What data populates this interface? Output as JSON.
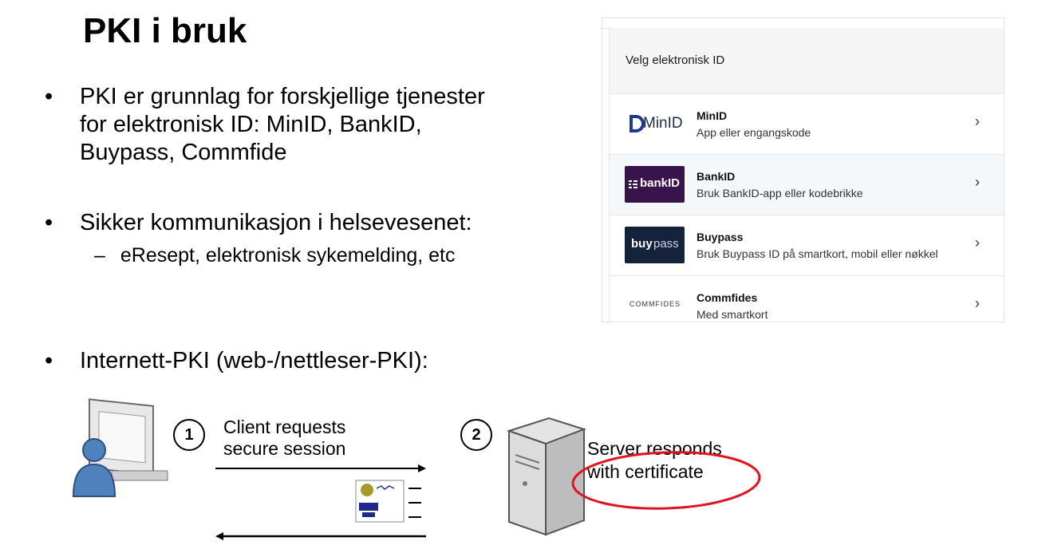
{
  "title": "PKI i bruk",
  "bullets": [
    {
      "lines": [
        "PKI er grunnlag for forskjellige tjenester",
        "for elektronisk ID: MinID, BankID,",
        "Buypass, Commfide"
      ]
    },
    {
      "lines": [
        "Sikker kommunikasjon i helsevesenet:"
      ]
    },
    {
      "lines": [
        "Internett-PKI (web-/nettleser-PKI):"
      ]
    }
  ],
  "bullet_symbol": "•",
  "sub_bullet": {
    "dash": "–",
    "text": "eResept, elektronisk sykemelding, etc"
  },
  "eid_panel": {
    "header": "Velg elektronisk ID",
    "chevron": "›",
    "options": [
      {
        "name": "MinID",
        "desc": "App eller engangskode",
        "logo_text": "MinID",
        "logo_mark": "D"
      },
      {
        "name": "BankID",
        "desc": "Bruk BankID-app eller kodebrikke",
        "logo_text": "bankID"
      },
      {
        "name": "Buypass",
        "desc": "Bruk Buypass ID på smartkort, mobil eller nøkkel",
        "logo_text_bold": "buy",
        "logo_text_light": "pass"
      },
      {
        "name": "Commfides",
        "desc": "Med smartkort",
        "logo_text": "COMMFIDES"
      }
    ]
  },
  "diagram": {
    "step1": {
      "num": "1",
      "label_lines": [
        "Client requests",
        "secure session"
      ]
    },
    "step2": {
      "num": "2",
      "label_lines": [
        "Server responds",
        "with certificate"
      ]
    },
    "colors": {
      "highlight": "#e0141e",
      "person": "#4f81bd"
    }
  }
}
